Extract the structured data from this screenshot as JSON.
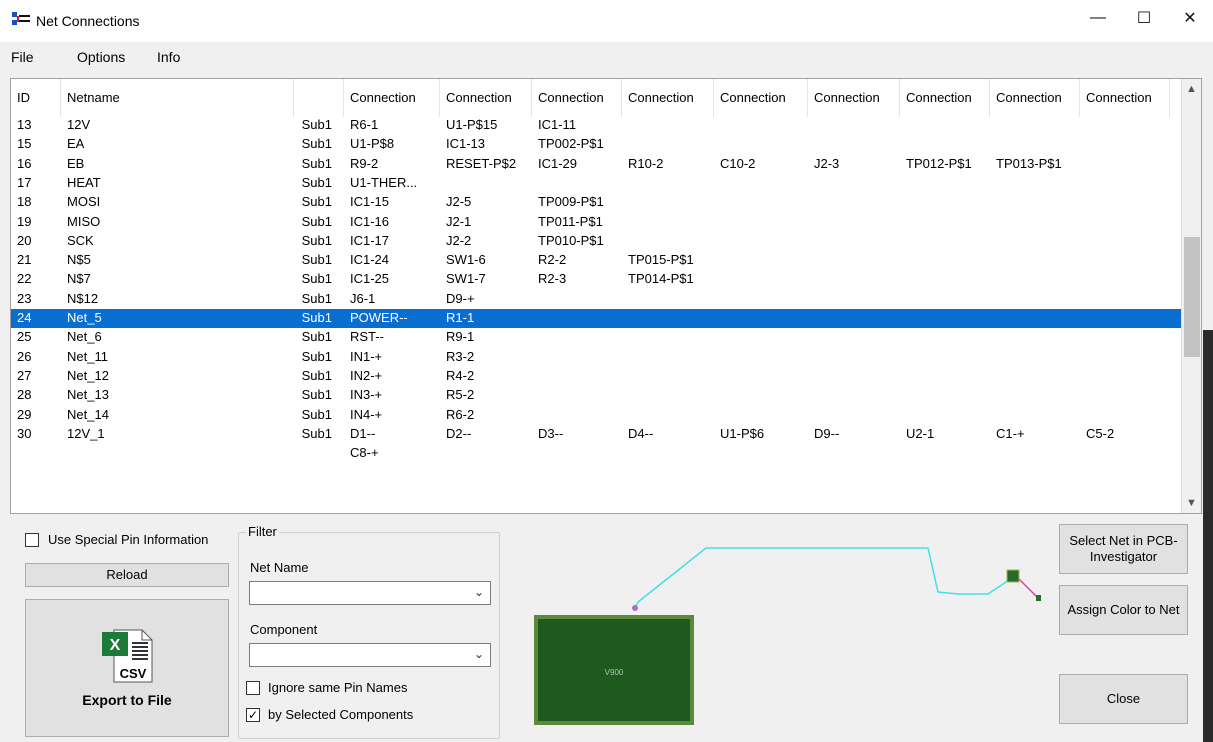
{
  "window": {
    "title": "Net Connections",
    "minimize_glyph": "—",
    "maximize_glyph": "☐",
    "close_glyph": "✕"
  },
  "menu": [
    "File",
    "Options",
    "Info"
  ],
  "grid": {
    "headers": [
      "ID",
      "Netname",
      "",
      "Connection",
      "Connection",
      "Connection",
      "Connection",
      "Connection",
      "Connection",
      "Connection",
      "Connection",
      "Connection"
    ],
    "selected_id": "24",
    "rows": [
      {
        "id": "13",
        "net": "12V",
        "sub": "Sub1",
        "c": [
          "R6-1",
          "U1-P$15",
          "IC1-11"
        ]
      },
      {
        "id": "15",
        "net": "EA",
        "sub": "Sub1",
        "c": [
          "U1-P$8",
          "IC1-13",
          "TP002-P$1"
        ]
      },
      {
        "id": "16",
        "net": "EB",
        "sub": "Sub1",
        "c": [
          "R9-2",
          "RESET-P$2",
          "IC1-29",
          "R10-2",
          "C10-2",
          "J2-3",
          "TP012-P$1",
          "TP013-P$1"
        ]
      },
      {
        "id": "17",
        "net": "HEAT",
        "sub": "Sub1",
        "c": [
          "U1-THER..."
        ]
      },
      {
        "id": "18",
        "net": "MOSI",
        "sub": "Sub1",
        "c": [
          "IC1-15",
          "J2-5",
          "TP009-P$1"
        ]
      },
      {
        "id": "19",
        "net": "MISO",
        "sub": "Sub1",
        "c": [
          "IC1-16",
          "J2-1",
          "TP011-P$1"
        ]
      },
      {
        "id": "20",
        "net": "SCK",
        "sub": "Sub1",
        "c": [
          "IC1-17",
          "J2-2",
          "TP010-P$1"
        ]
      },
      {
        "id": "21",
        "net": "N$5",
        "sub": "Sub1",
        "c": [
          "IC1-24",
          "SW1-6",
          "R2-2",
          "TP015-P$1"
        ]
      },
      {
        "id": "22",
        "net": "N$7",
        "sub": "Sub1",
        "c": [
          "IC1-25",
          "SW1-7",
          "R2-3",
          "TP014-P$1"
        ]
      },
      {
        "id": "23",
        "net": "N$12",
        "sub": "Sub1",
        "c": [
          "J6-1",
          "D9-+"
        ]
      },
      {
        "id": "24",
        "net": "Net_5",
        "sub": "Sub1",
        "c": [
          "POWER--",
          "R1-1"
        ]
      },
      {
        "id": "25",
        "net": "Net_6",
        "sub": "Sub1",
        "c": [
          "RST--",
          "R9-1"
        ]
      },
      {
        "id": "26",
        "net": "Net_11",
        "sub": "Sub1",
        "c": [
          "IN1-+",
          "R3-2"
        ]
      },
      {
        "id": "27",
        "net": "Net_12",
        "sub": "Sub1",
        "c": [
          "IN2-+",
          "R4-2"
        ]
      },
      {
        "id": "28",
        "net": "Net_13",
        "sub": "Sub1",
        "c": [
          "IN3-+",
          "R5-2"
        ]
      },
      {
        "id": "29",
        "net": "Net_14",
        "sub": "Sub1",
        "c": [
          "IN4-+",
          "R6-2"
        ]
      },
      {
        "id": "30",
        "net": "12V_1",
        "sub": "Sub1",
        "c": [
          "D1--",
          "D2--",
          "D3--",
          "D4--",
          "U1-P$6",
          "D9--",
          "U2-1",
          "C1-+",
          "C5-2"
        ]
      },
      {
        "id": "",
        "net": "",
        "sub": "",
        "c": [
          "C8-+"
        ]
      }
    ]
  },
  "controls": {
    "use_special_pin": {
      "label": "Use Special Pin Information",
      "checked": false
    },
    "reload": "Reload",
    "export": {
      "icon_text": "CSV",
      "label": "Export to File"
    },
    "filter": {
      "title": "Filter",
      "net_name_label": "Net Name",
      "net_name_value": "",
      "component_label": "Component",
      "component_value": "",
      "ignore_same": {
        "label": "Ignore same Pin Names",
        "checked": false
      },
      "by_selected": {
        "label": "by Selected Components",
        "checked": true
      },
      "checkmark": "✓"
    },
    "select_net": "Select Net in PCB-Investigator",
    "assign_color": "Assign Color to Net",
    "close": "Close"
  },
  "preview": {
    "chip_label": "V900"
  },
  "colors": {
    "selection": "#0a6ed1",
    "trace": "#40e0e8",
    "trace2": "#e040a0",
    "pcb": "#1e5a1e"
  }
}
